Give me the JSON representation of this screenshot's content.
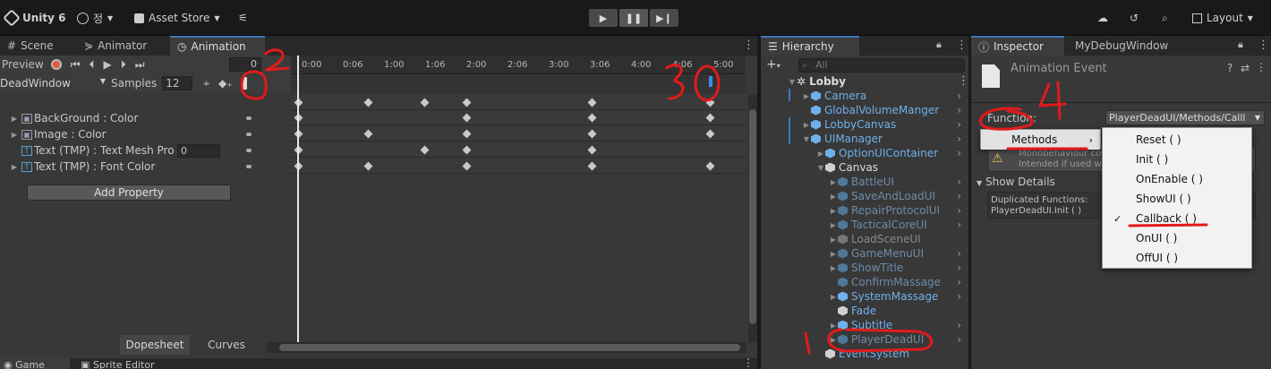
{
  "topbar": {
    "app": "Unity 6",
    "account": "정",
    "store": "Asset Store",
    "layout": "Layout"
  },
  "animation_panel": {
    "tabs": [
      "Scene",
      "Animator",
      "Animation"
    ],
    "preview": "Preview",
    "frame": "0",
    "clip": "DeadWindow",
    "samples_label": "Samples",
    "samples_value": "12",
    "ruler": [
      "0:00",
      "0:06",
      "1:00",
      "1:06",
      "2:00",
      "2:06",
      "3:00",
      "3:06",
      "4:00",
      "4:06",
      "5:00"
    ],
    "properties": [
      {
        "label": "BackGround : Color",
        "icon": "image-icon"
      },
      {
        "label": "Image : Color",
        "icon": "image-icon"
      },
      {
        "label": "Text (TMP) : Text Mesh Pro",
        "icon": "text-icon",
        "value": "0"
      },
      {
        "label": "Text (TMP) : Font Color",
        "icon": "text-icon"
      }
    ],
    "add_property": "Add Property",
    "dopesheet": "Dopesheet",
    "curves": "Curves"
  },
  "bottom_tabs": [
    "Game",
    "Sprite Editor"
  ],
  "hierarchy": {
    "title": "Hierarchy",
    "search_placeholder": "All",
    "root": "Lobby",
    "items": [
      {
        "label": "Camera"
      },
      {
        "label": "GlobalVolumeManger"
      },
      {
        "label": "LobbyCanvas"
      },
      {
        "label": "UIManager"
      },
      {
        "label": "OptionUIContainer"
      },
      {
        "label": "Canvas"
      },
      {
        "label": "BattleUI"
      },
      {
        "label": "SaveAndLoadUI"
      },
      {
        "label": "RepairProtocolUI"
      },
      {
        "label": "TacticalCoreUI"
      },
      {
        "label": "LoadSceneUI"
      },
      {
        "label": "GameMenuUI"
      },
      {
        "label": "ShowTitle"
      },
      {
        "label": "ConfirmMassage"
      },
      {
        "label": "SystemMassage"
      },
      {
        "label": "Fade"
      },
      {
        "label": "Subtitle"
      },
      {
        "label": "PlayerDeadUI"
      },
      {
        "label": "EventSystem"
      }
    ]
  },
  "inspector": {
    "tabs": [
      "Inspector",
      "MyDebugWindow"
    ],
    "header": "Animation Event",
    "function_label": "Function:",
    "function_value": "PlayerDeadUI/Methods/Calll",
    "methods": "Methods",
    "warning_line1": "Monobehaviour con",
    "warning_line2": "Intended if used wi",
    "show_details": "Show Details",
    "dup_line1": "Duplicated Functions:",
    "dup_line2": "PlayerDeadUI.Init ( )",
    "menu_items": [
      "Reset ( )",
      "Init ( )",
      "OnEnable ( )",
      "ShowUI ( )",
      "Callback ( )",
      "OnUI ( )",
      "OffUI ( )"
    ],
    "selected_item": "Callback ( )"
  },
  "annotations": [
    "1",
    "2",
    "30",
    "4"
  ]
}
